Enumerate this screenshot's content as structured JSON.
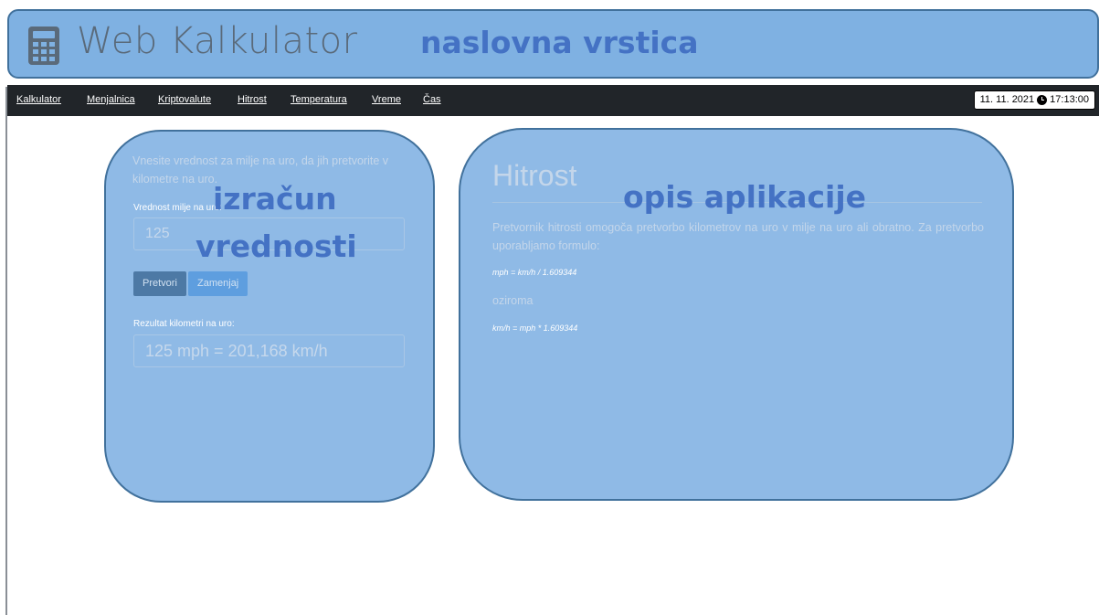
{
  "header": {
    "app_title": "Web Kalkulator",
    "region_label": "naslovna vrstica",
    "icon": "calculator-icon"
  },
  "nav": {
    "items": [
      "Kalkulator",
      "Menjalnica",
      "Kriptovalute",
      "Hitrost",
      "Temperatura",
      "Vreme",
      "Čas"
    ],
    "date": "11. 11. 2021",
    "time": "17:13:00",
    "clock_icon": "clock-icon"
  },
  "converter": {
    "intro": "Vnesite vrednost za milje na uro, da jih pretvorite v kilometre na uro.",
    "input_label": "Vrednost milje na uro:",
    "input_value": "125",
    "convert_button": "Pretvori",
    "swap_button": "Zamenjaj",
    "result_label": "Rezultat kilometri na uro:",
    "result_value": "125 mph = 201,168 km/h",
    "region_label_line1": "izračun",
    "region_label_line2": "vrednosti"
  },
  "description": {
    "title": "Hitrost",
    "text": "Pretvornik hitrosti omogoča pretvorbo kilometrov na uro v milje na uro ali obratno. Za pretvorbo uporabljamo formulo:",
    "formula1": "mph = km/h / 1.609344",
    "or_text": "oziroma",
    "formula2": "km/h = mph * 1.609344",
    "region_label": "opis aplikacije"
  },
  "colors": {
    "overlay_fill": "#7fb1e2",
    "overlay_border": "#41719c",
    "overlay_label": "#4472c4",
    "navbar": "#212529"
  }
}
